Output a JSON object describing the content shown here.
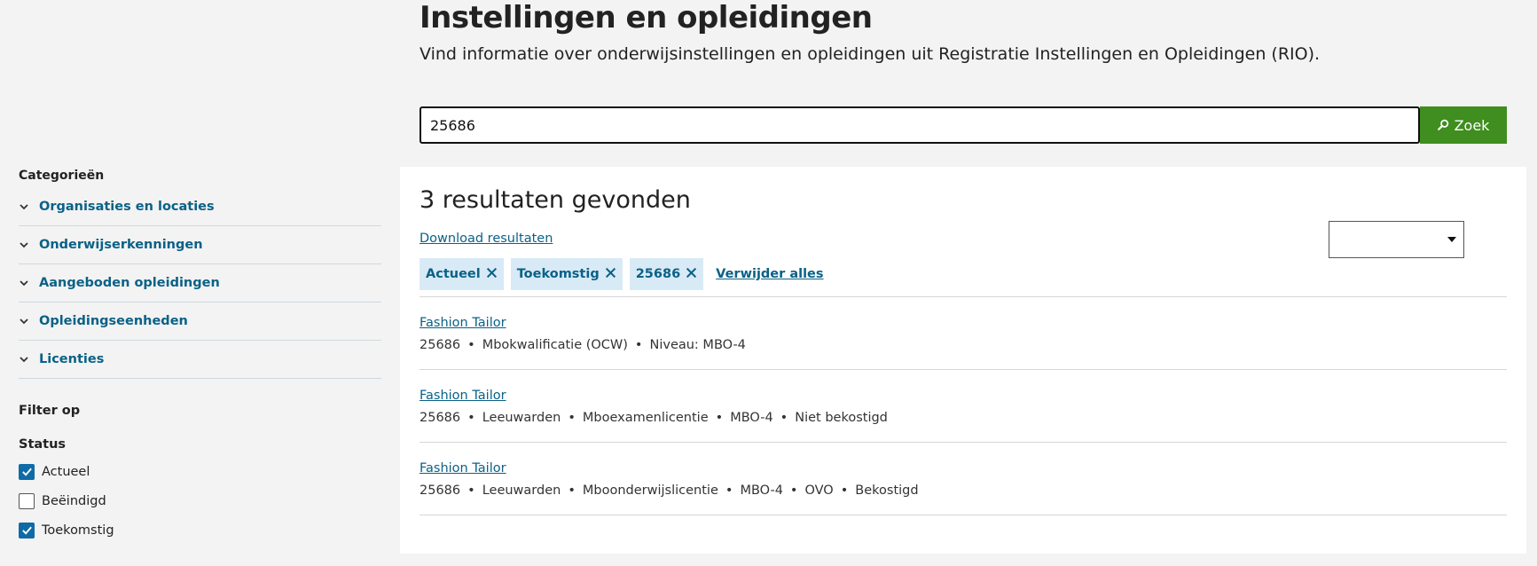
{
  "header": {
    "title": "Instellingen en opleidingen",
    "subtitle": "Vind informatie over onderwijsinstellingen en opleidingen uit Registratie Instellingen en Opleidingen (RIO)."
  },
  "search": {
    "value": "25686",
    "button_label": "Zoek",
    "button_icon": "search-icon"
  },
  "sidebar": {
    "categories_heading": "Categorieën",
    "categories": [
      {
        "label": "Organisaties en locaties"
      },
      {
        "label": "Onderwijserkenningen"
      },
      {
        "label": "Aangeboden opleidingen"
      },
      {
        "label": "Opleidingseenheden"
      },
      {
        "label": "Licenties"
      }
    ],
    "filter_heading": "Filter op",
    "status_heading": "Status",
    "statuses": [
      {
        "label": "Actueel",
        "checked": true
      },
      {
        "label": "Beëindigd",
        "checked": false
      },
      {
        "label": "Toekomstig",
        "checked": true
      }
    ]
  },
  "results": {
    "count_text": "3 resultaten gevonden",
    "download_label": "Download resultaten",
    "sort_value": "",
    "chips": [
      {
        "label": "Actueel"
      },
      {
        "label": "Toekomstig"
      },
      {
        "label": "25686"
      }
    ],
    "remove_all_label": "Verwijder alles",
    "items": [
      {
        "title": "Fashion Tailor",
        "meta": [
          "25686",
          "Mbokwalificatie (OCW)",
          "Niveau: MBO-4"
        ]
      },
      {
        "title": "Fashion Tailor",
        "meta": [
          "25686",
          "Leeuwarden",
          "Mboexamenlicentie",
          "MBO-4",
          "Niet bekostigd"
        ]
      },
      {
        "title": "Fashion Tailor",
        "meta": [
          "25686",
          "Leeuwarden",
          "Mboonderwijslicentie",
          "MBO-4",
          "OVO",
          "Bekostigd"
        ]
      }
    ]
  },
  "colors": {
    "accent_green": "#3f8e1f",
    "link_blue": "#0a6187",
    "chip_bg": "#d8eaf6",
    "checkbox_blue": "#0f6ba6"
  }
}
